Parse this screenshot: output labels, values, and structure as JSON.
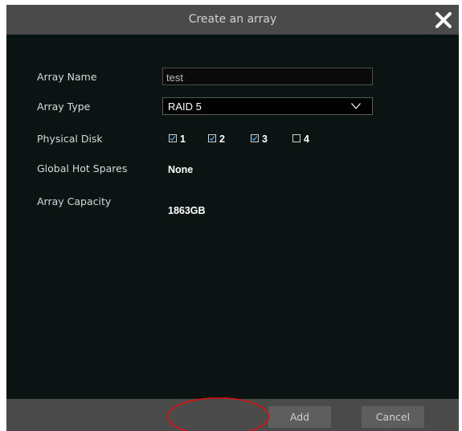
{
  "dialog": {
    "title": "Create an array",
    "close_icon": "close-x-icon"
  },
  "form": {
    "array_name": {
      "label": "Array Name",
      "value": "test"
    },
    "array_type": {
      "label": "Array Type",
      "value": "RAID 5",
      "icon": "chevron-down-icon"
    },
    "physical_disk": {
      "label": "Physical Disk",
      "disks": [
        {
          "label": "1",
          "checked": true
        },
        {
          "label": "2",
          "checked": true
        },
        {
          "label": "3",
          "checked": true
        },
        {
          "label": "4",
          "checked": false
        }
      ]
    },
    "global_hot_spares": {
      "label": "Global Hot Spares",
      "value": "None"
    },
    "array_capacity": {
      "label": "Array Capacity",
      "value": "1863GB"
    }
  },
  "footer": {
    "add_label": "Add",
    "cancel_label": "Cancel"
  },
  "colors": {
    "dialog_bg": "#0a1513",
    "bar_bg": "#4a4a4a",
    "button_bg": "#5e5e5e",
    "check_color": "#4aa3df",
    "annotation_color": "#e01010"
  }
}
